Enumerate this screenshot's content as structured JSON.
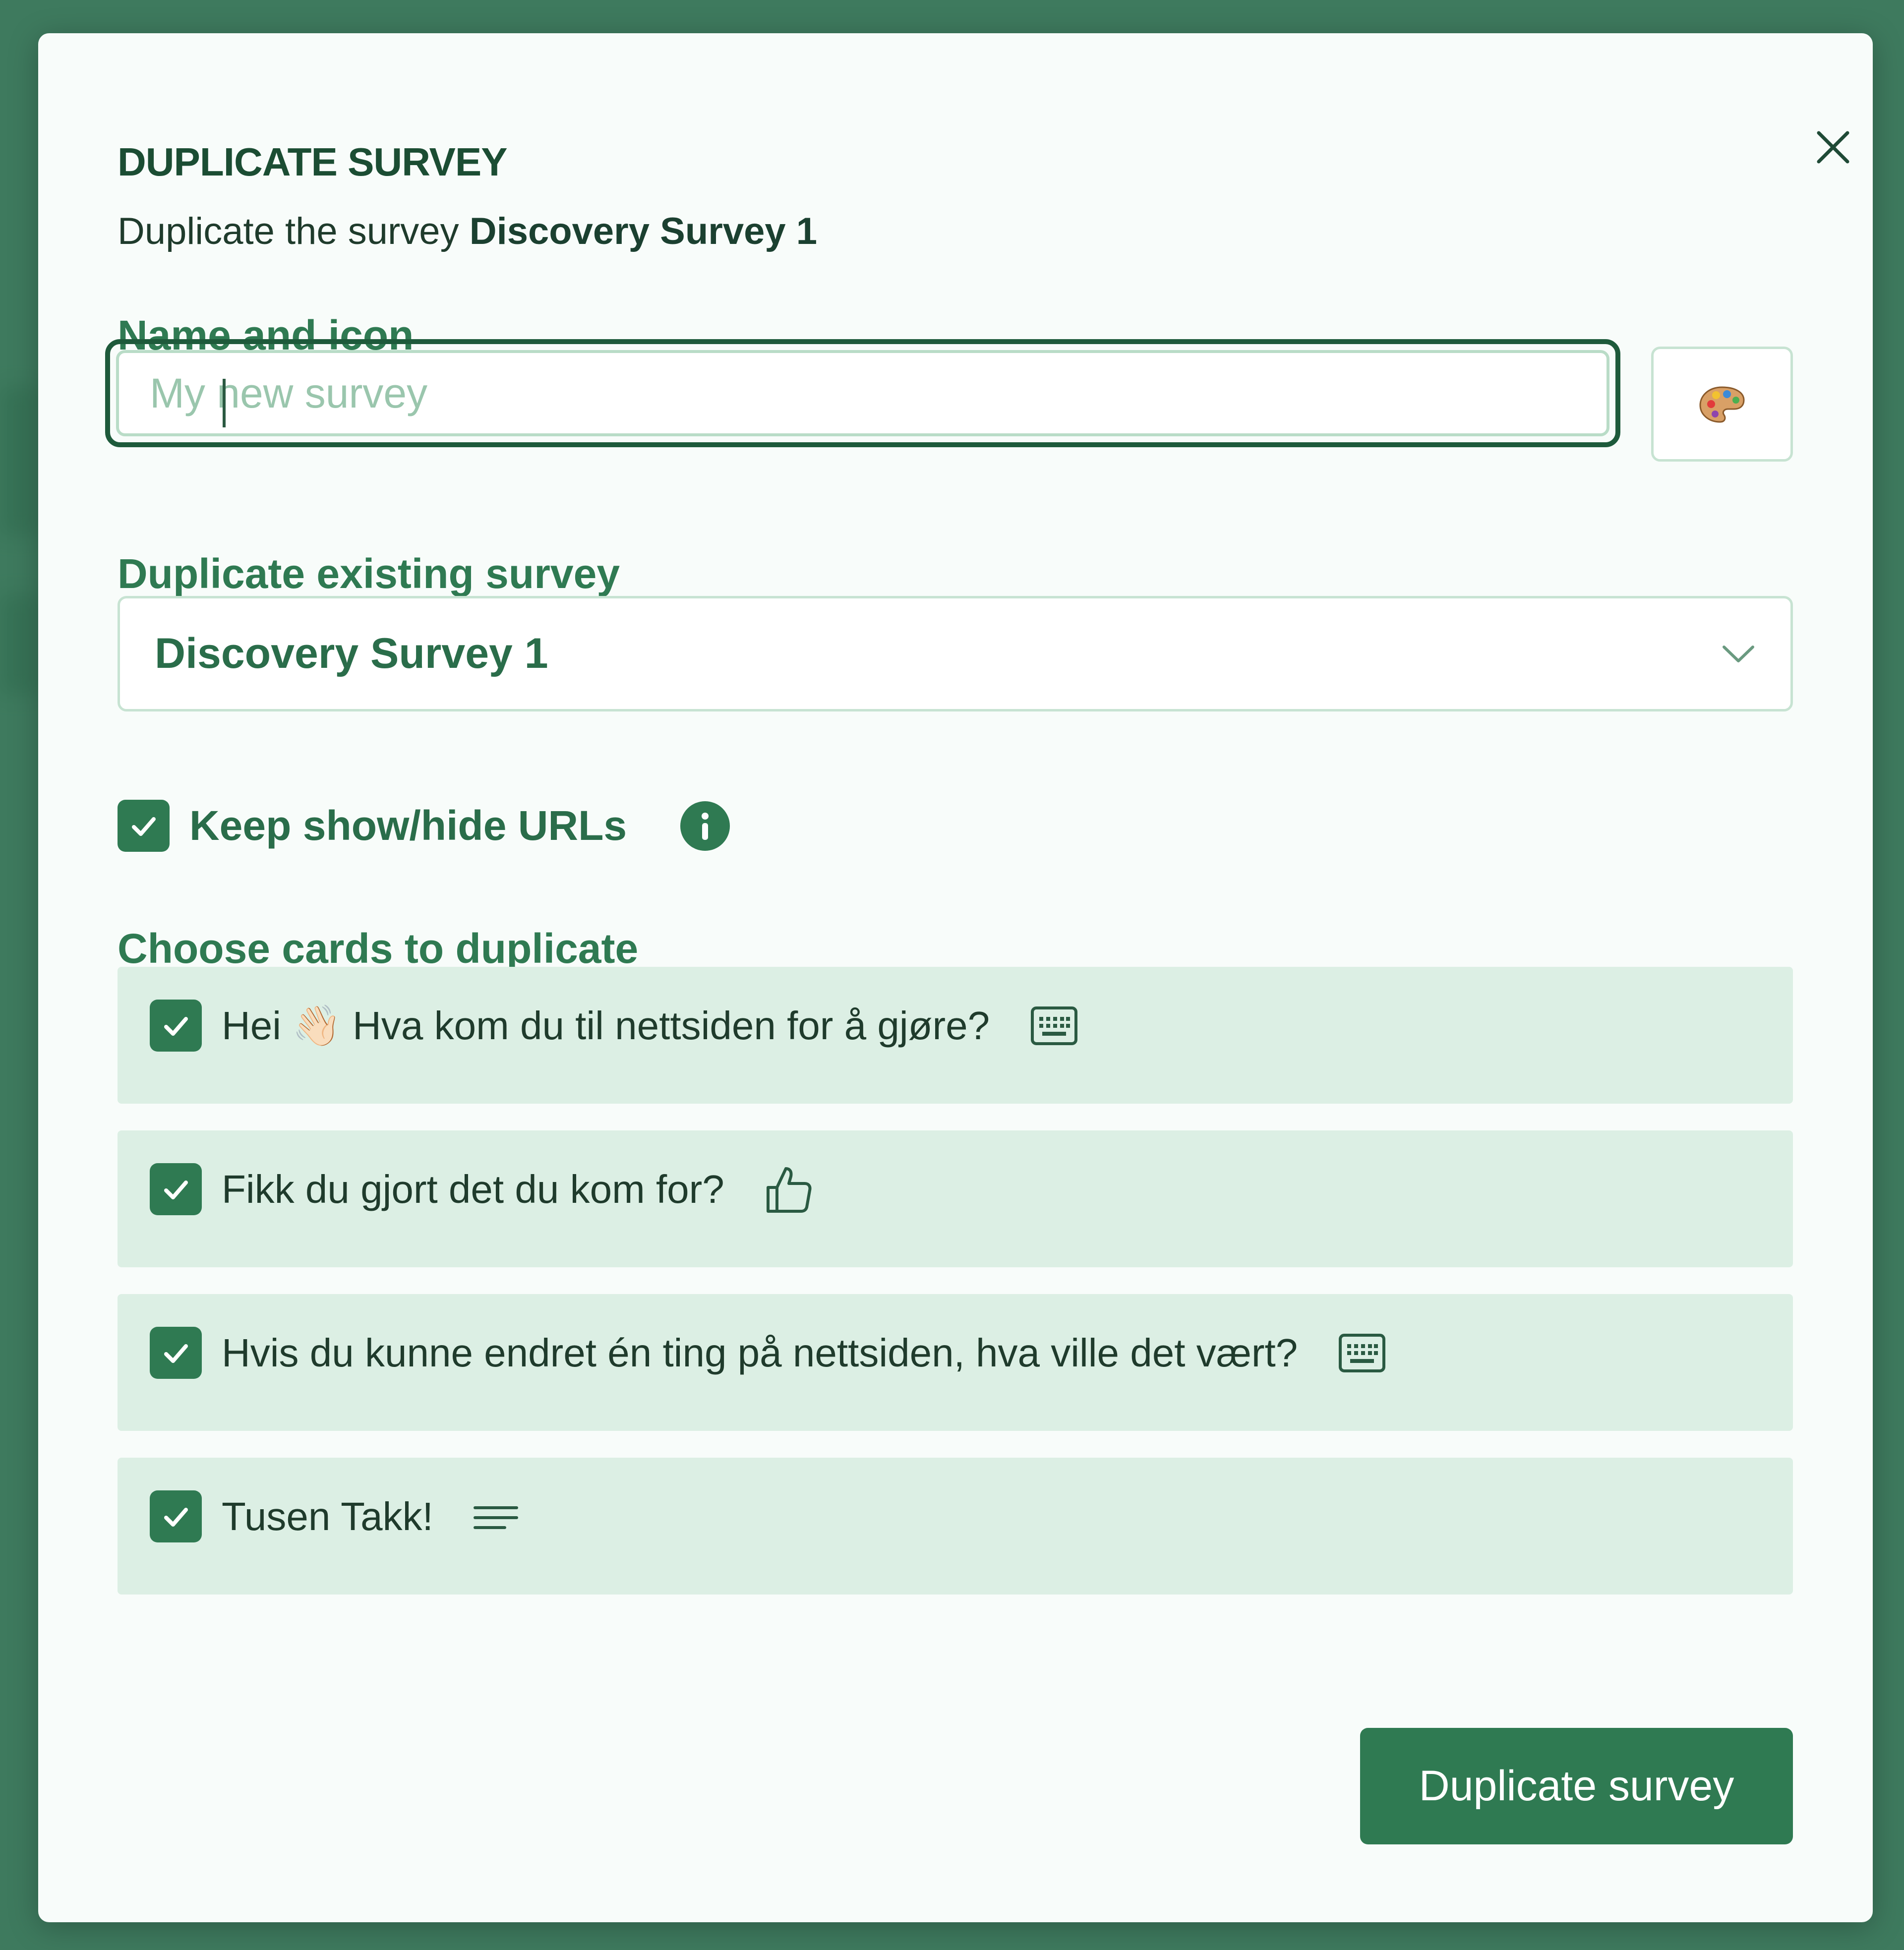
{
  "dialog": {
    "title": "DUPLICATE SURVEY",
    "subtitle_prefix": "Duplicate the survey ",
    "subtitle_name": "Discovery Survey 1",
    "close_icon": "close-icon"
  },
  "name_section": {
    "label": "Name and icon",
    "input_value": "",
    "input_placeholder": "My new survey",
    "icon_button_icon": "palette-icon"
  },
  "source_section": {
    "label": "Duplicate existing survey",
    "selected": "Discovery Survey 1",
    "dropdown_icon": "chevron-down-icon"
  },
  "keep_urls": {
    "label": "Keep show/hide URLs",
    "checked": true,
    "info_icon": "info-icon"
  },
  "cards_section": {
    "label": "Choose cards to duplicate",
    "cards": [
      {
        "text": "Hei 👋🏻 Hva kom du til nettsiden for å gjøre?",
        "type_icon": "keyboard-icon",
        "checked": true
      },
      {
        "text": "Fikk du gjort det du kom for?",
        "type_icon": "thumbs-up-icon",
        "checked": true
      },
      {
        "text": "Hvis du kunne endret én ting på nettsiden, hva ville det vært?",
        "type_icon": "keyboard-icon",
        "checked": true
      },
      {
        "text": "Tusen Takk!",
        "type_icon": "text-lines-icon",
        "checked": true
      }
    ]
  },
  "actions": {
    "primary_label": "Duplicate survey"
  },
  "colors": {
    "primary": "#2f7a52",
    "card_background": "#dcefe4",
    "heading": "#1b4d33",
    "backdrop": "#3e7a5e"
  }
}
